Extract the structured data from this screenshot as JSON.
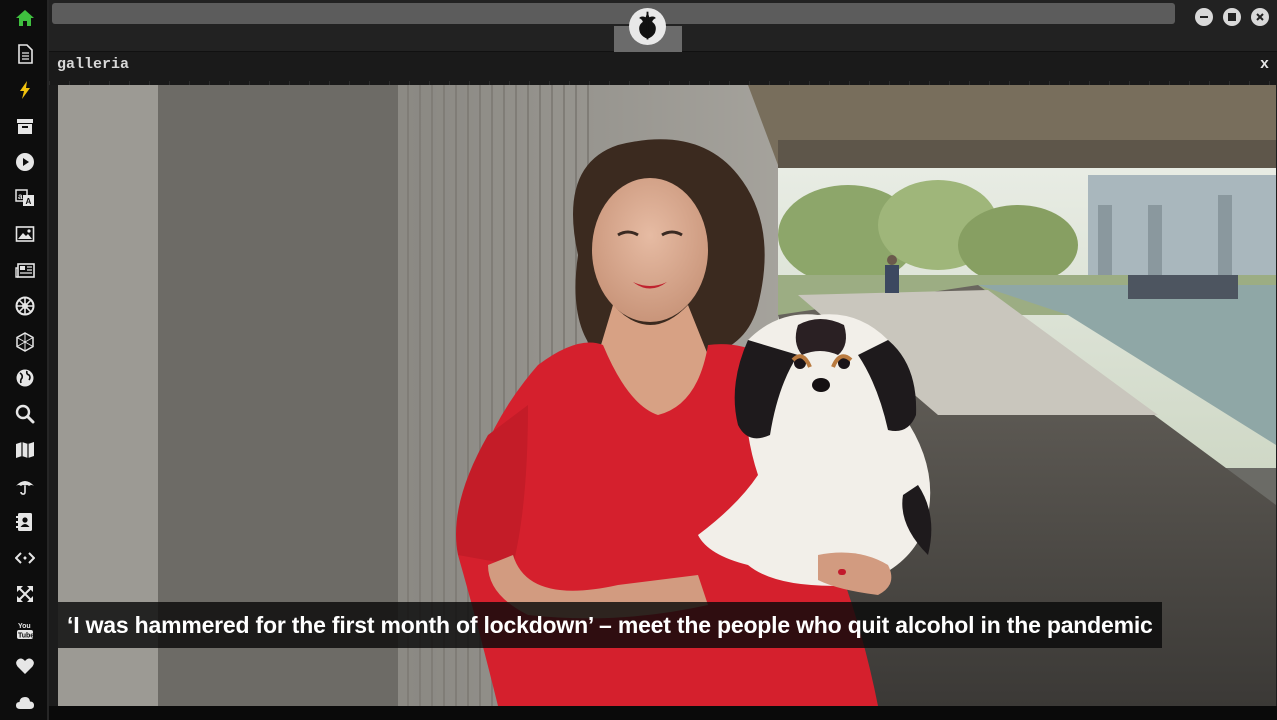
{
  "sidebar": {
    "icons": [
      {
        "name": "home-icon",
        "color": "#3fbf3f"
      },
      {
        "name": "document-icon"
      },
      {
        "name": "lightning-icon",
        "color": "#f2c30f"
      },
      {
        "name": "archive-icon"
      },
      {
        "name": "play-icon"
      },
      {
        "name": "translate-icon"
      },
      {
        "name": "image-icon"
      },
      {
        "name": "newspaper-icon"
      },
      {
        "name": "empire-icon"
      },
      {
        "name": "hexagon-network-icon"
      },
      {
        "name": "globe-icon"
      },
      {
        "name": "search-icon"
      },
      {
        "name": "map-icon"
      },
      {
        "name": "umbrella-icon"
      },
      {
        "name": "address-book-icon"
      },
      {
        "name": "code-icon"
      },
      {
        "name": "fullscreen-icon"
      },
      {
        "name": "youtube-icon",
        "text": "You Tube"
      },
      {
        "name": "heart-icon"
      },
      {
        "name": "cloud-icon"
      }
    ]
  },
  "topbar": {
    "logo": "rebel-alliance-logo",
    "window_controls": [
      "minimize-icon",
      "maximize-icon",
      "close-icon"
    ]
  },
  "gallery": {
    "title": "galleria",
    "close_label": "x",
    "caption": "‘I was hammered for the first month of lockdown’ – meet the people who quit alcohol in the pandemic"
  },
  "colors": {
    "sidebar_bg": "#0d0d0d",
    "icon": "#e6e6e6",
    "topbar_bg": "#222222",
    "caption_bg": "#0a0a0a"
  }
}
